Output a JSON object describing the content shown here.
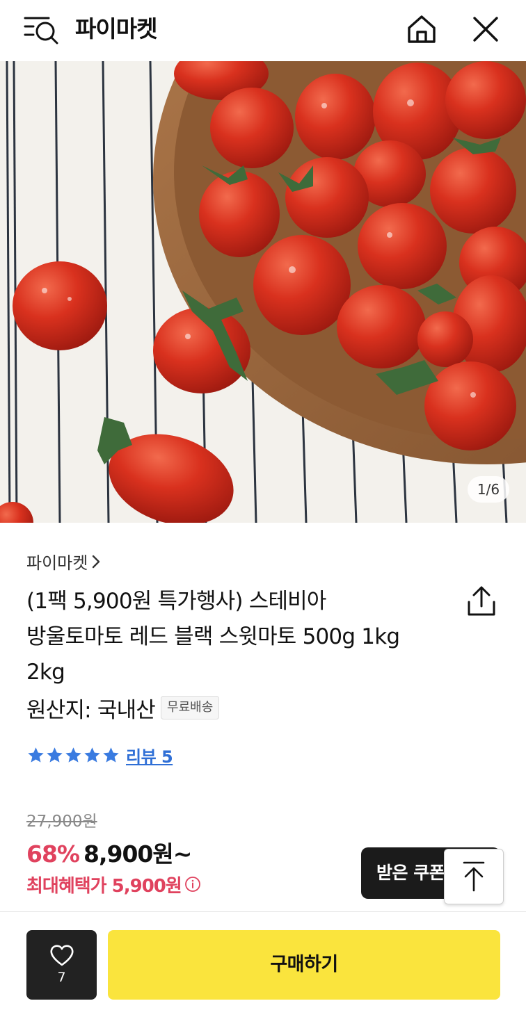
{
  "header": {
    "title": "파이마켓",
    "menu_icon": "menu-search-icon",
    "home_icon": "home-icon",
    "close_icon": "close-icon"
  },
  "hero": {
    "page_counter": "1/6"
  },
  "product": {
    "seller": "파이마켓",
    "title_lines": [
      "(1팩 5,900원 특가행사) 스테비아",
      "방울토마토 레드 블랙 스윗마토 500g 1kg",
      "2kg"
    ],
    "origin": "원산지: 국내산",
    "shipping_badge": "무료배송",
    "rating_stars": 5,
    "review_label": "리뷰 5",
    "original_price": "27,900원",
    "discount": "68%",
    "sale_price": "8,900원~",
    "max_benefit": "최대혜택가 5,900원"
  },
  "actions": {
    "coupon_label": "받은 쿠폰",
    "like_count": "7",
    "buy_label": "구매하기"
  },
  "colors": {
    "accent_red": "#e0425e",
    "buy_yellow": "#fae43d",
    "link_blue": "#2f6fd6",
    "dark": "#1b1b1b"
  }
}
